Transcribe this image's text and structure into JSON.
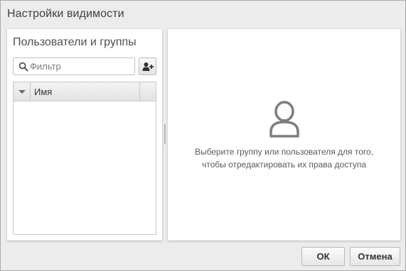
{
  "dialog": {
    "title": "Настройки видимости"
  },
  "left_panel": {
    "heading": "Пользователи и группы",
    "search": {
      "placeholder": "Фильтр",
      "value": ""
    },
    "add_button_icon": "add-user-icon",
    "grid": {
      "columns": [
        "Имя"
      ],
      "rows": []
    }
  },
  "right_panel": {
    "icon": "user-icon",
    "message_line1": "Выберите группу или пользователя для того,",
    "message_line2": "чтобы отредактировать их права доступа"
  },
  "footer": {
    "ok_label": "ОК",
    "cancel_label": "Отмена"
  }
}
